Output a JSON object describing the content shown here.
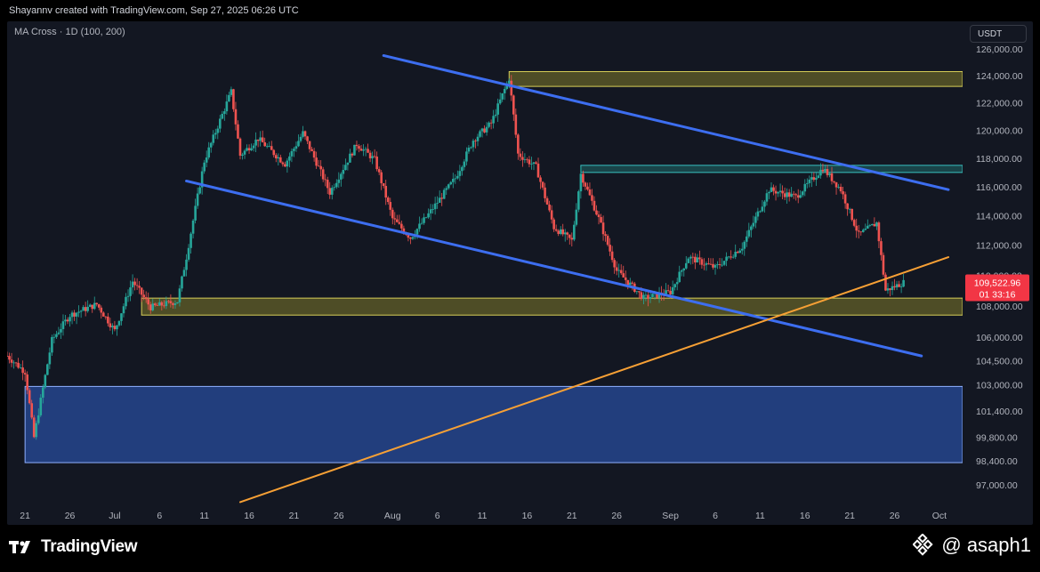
{
  "header": {
    "credit": "Shayannv created with TradingView.com, Sep 27, 2025 06:26 UTC"
  },
  "indicator": {
    "label": "MA Cross · 1D (100, 200)"
  },
  "currency": {
    "label": "USDT"
  },
  "footer": {
    "brand": "TradingView",
    "author": "@ asaph1"
  },
  "colors": {
    "background": "#131722",
    "up": "#26a69a",
    "down": "#ef5350",
    "channel": "#3d6ef0",
    "trendline": "#f7a035",
    "demand_zone": "#807a2a",
    "supply_zone_top": "#807a2a",
    "resistance_zone": "#1f6a6a",
    "support_zone_low": "#2f5ec8",
    "price_tag": "#f23645"
  },
  "chart_data": {
    "type": "candlestick",
    "title": "",
    "timeframe": "1D",
    "symbol_currency": "USDT",
    "x_ticks": [
      "21",
      "26",
      "Jul",
      "6",
      "11",
      "16",
      "21",
      "26",
      "Aug",
      "6",
      "11",
      "16",
      "21",
      "26",
      "Sep",
      "6",
      "11",
      "16",
      "21",
      "26",
      "Oct"
    ],
    "x_range": [
      "2025-06-19",
      "2025-10-02"
    ],
    "y_ticks": [
      "126,000.00",
      "124,000.00",
      "122,000.00",
      "120,000.00",
      "118,000.00",
      "116,000.00",
      "114,000.00",
      "112,000.00",
      "110,000.00",
      "108,000.00",
      "106,000.00",
      "104,500.00",
      "103,000.00",
      "101,400.00",
      "99,800.00",
      "98,400.00",
      "97,000.00"
    ],
    "y_scale": "log",
    "ylim": [
      96000,
      127000
    ],
    "last_price": "109,522.96",
    "countdown": "01 33:16",
    "price_path": [
      [
        "2025-06-19",
        104800
      ],
      [
        "2025-06-21",
        103800
      ],
      [
        "2025-06-22",
        99800
      ],
      [
        "2025-06-24",
        105800
      ],
      [
        "2025-06-26",
        107400
      ],
      [
        "2025-06-29",
        108100
      ],
      [
        "2025-07-01",
        106400
      ],
      [
        "2025-07-03",
        109600
      ],
      [
        "2025-07-05",
        107900
      ],
      [
        "2025-07-08",
        108300
      ],
      [
        "2025-07-09",
        111200
      ],
      [
        "2025-07-11",
        117800
      ],
      [
        "2025-07-14",
        122800
      ],
      [
        "2025-07-15",
        118200
      ],
      [
        "2025-07-17",
        119400
      ],
      [
        "2025-07-20",
        117600
      ],
      [
        "2025-07-22",
        119800
      ],
      [
        "2025-07-25",
        115600
      ],
      [
        "2025-07-28",
        119000
      ],
      [
        "2025-07-30",
        117900
      ],
      [
        "2025-08-01",
        113800
      ],
      [
        "2025-08-03",
        112500
      ],
      [
        "2025-08-05",
        114100
      ],
      [
        "2025-08-08",
        116600
      ],
      [
        "2025-08-10",
        119300
      ],
      [
        "2025-08-12",
        120500
      ],
      [
        "2025-08-14",
        123800
      ],
      [
        "2025-08-15",
        118300
      ],
      [
        "2025-08-17",
        117400
      ],
      [
        "2025-08-19",
        113200
      ],
      [
        "2025-08-21",
        112300
      ],
      [
        "2025-08-22",
        116900
      ],
      [
        "2025-08-24",
        113800
      ],
      [
        "2025-08-26",
        110300
      ],
      [
        "2025-08-29",
        108500
      ],
      [
        "2025-09-01",
        108900
      ],
      [
        "2025-09-03",
        111200
      ],
      [
        "2025-09-06",
        110500
      ],
      [
        "2025-09-09",
        111900
      ],
      [
        "2025-09-12",
        115800
      ],
      [
        "2025-09-15",
        115300
      ],
      [
        "2025-09-18",
        117300
      ],
      [
        "2025-09-20",
        115800
      ],
      [
        "2025-09-22",
        112700
      ],
      [
        "2025-09-24",
        113500
      ],
      [
        "2025-09-25",
        109000
      ],
      [
        "2025-09-27",
        109523
      ]
    ],
    "drawings": {
      "channel_upper": {
        "from": [
          "2025-07-31",
          125500
        ],
        "to": [
          "2025-10-02",
          115800
        ]
      },
      "channel_lower": {
        "from": [
          "2025-07-09",
          116400
        ],
        "to": [
          "2025-09-29",
          104800
        ]
      },
      "ascending_trendline": {
        "from": [
          "2025-07-15",
          96000
        ],
        "to": [
          "2025-10-02",
          111200
        ]
      },
      "zone_top": {
        "x_from": "2025-08-14",
        "price_from": 123200,
        "price_to": 124300
      },
      "zone_resistance": {
        "x_from": "2025-08-22",
        "price_from": 117000,
        "price_to": 117500
      },
      "zone_demand": {
        "x_from": "2025-07-04",
        "price_from": 107400,
        "price_to": 108500
      },
      "zone_low": {
        "x_from": "2025-06-21",
        "price_from": 98300,
        "price_to": 102900
      }
    }
  }
}
